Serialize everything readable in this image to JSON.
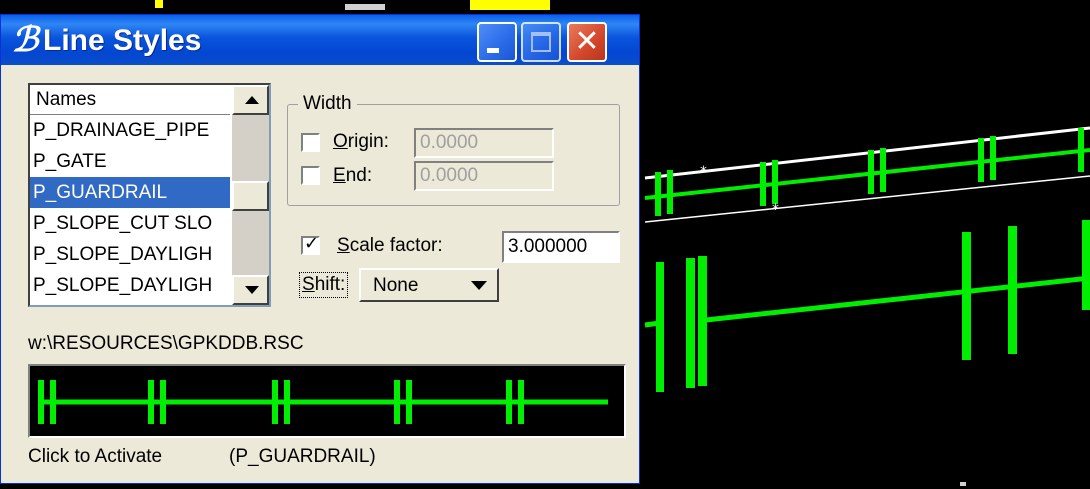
{
  "window": {
    "title": "Line Styles",
    "app_icon": "microstation-icon",
    "buttons": {
      "minimize": "minimize-icon",
      "maximize": "maximize-icon",
      "close_glyph": "✕"
    }
  },
  "names_list": {
    "header": "Names",
    "items": [
      {
        "label": "P_DRAINAGE_PIPE",
        "selected": false
      },
      {
        "label": "P_GATE",
        "selected": false
      },
      {
        "label": "P_GUARDRAIL",
        "selected": true
      },
      {
        "label": "P_SLOPE_CUT SLO",
        "selected": false
      },
      {
        "label": "P_SLOPE_DAYLIGH",
        "selected": false
      },
      {
        "label": "P_SLOPE_DAYLIGH",
        "selected": false
      }
    ]
  },
  "width_group": {
    "legend": "Width",
    "origin": {
      "label": "Origin:",
      "checked": false,
      "value": "0.0000"
    },
    "end": {
      "label": "End:",
      "checked": false,
      "value": "0.0000"
    }
  },
  "scale_factor": {
    "label": "Scale factor:",
    "checked": true,
    "value": "3.000000"
  },
  "shift": {
    "label": "Shift:",
    "value": "None"
  },
  "resource_path": "w:\\RESOURCES\\GPKDDB.RSC",
  "status": {
    "label": "Click to Activate",
    "value": "(P_GUARDRAIL)"
  },
  "colors": {
    "line": "#00ee00",
    "title_bar": "#0a55dc",
    "selection": "#316ac5",
    "dialog_bg": "#ece9d8"
  }
}
